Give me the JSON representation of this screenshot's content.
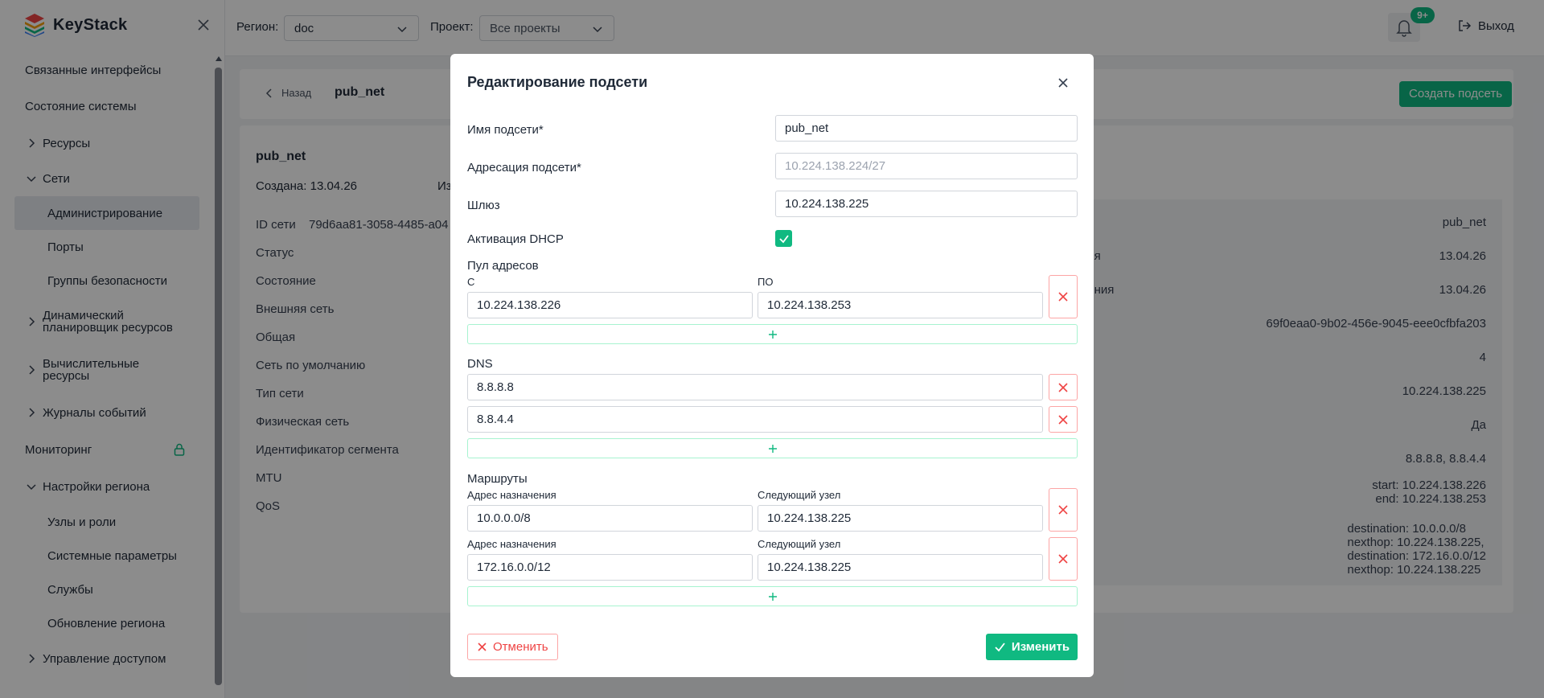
{
  "app": {
    "logo": "KeyStack"
  },
  "sidebar": {
    "items": [
      {
        "label": "Связанные интерфейсы"
      },
      {
        "label": "Состояние системы"
      },
      {
        "label": "Ресурсы"
      },
      {
        "label": "Сети"
      },
      {
        "label": "Администрирование"
      },
      {
        "label": "Порты"
      },
      {
        "label": "Группы безопасности"
      },
      {
        "label": "Динамический планировщик ресурсов"
      },
      {
        "label": "Вычислительные ресурсы"
      },
      {
        "label": "Журналы событий"
      },
      {
        "label": "Мониторинг"
      },
      {
        "label": "Настройки региона"
      },
      {
        "label": "Узлы и роли"
      },
      {
        "label": "Системные параметры"
      },
      {
        "label": "Службы"
      },
      {
        "label": "Обновление региона"
      },
      {
        "label": "Управление доступом"
      }
    ]
  },
  "topbar": {
    "region_label": "Регион:",
    "region_value": "doc",
    "project_label": "Проект:",
    "project_value": "Все проекты",
    "notifications_badge": "9+",
    "logout": "Выход"
  },
  "page": {
    "back": "Назад",
    "title": "pub_net",
    "create_button": "Создать подсеть",
    "network_name": "pub_net",
    "created": "Создана: 13.04.26",
    "changed_prefix": "Из",
    "fields": [
      {
        "label": "ID сети",
        "value": "79d6aa81-3058-4485-a04"
      },
      {
        "label": "Статус"
      },
      {
        "label": "Состояние"
      },
      {
        "label": "Внешняя сеть"
      },
      {
        "label": "Общая"
      },
      {
        "label": "Сеть по умолчанию"
      },
      {
        "label": "Тип сети"
      },
      {
        "label": "Физическая сеть"
      },
      {
        "label": "Идентификатор сегмента"
      },
      {
        "label": "MTU"
      },
      {
        "label": "QoS"
      }
    ],
    "subnet_panel": [
      {
        "label": "и",
        "value": "pub_net"
      },
      {
        "label": "ния",
        "value": "13.04.26"
      },
      {
        "label": "нения",
        "value": "13.04.26"
      },
      {
        "label": "",
        "value": "69f0eaa0-9b02-456e-9045-eee0cfbfa203"
      },
      {
        "label": "",
        "value": "4"
      },
      {
        "label": "",
        "value": "10.224.138.225"
      },
      {
        "label": "",
        "value": "Да"
      },
      {
        "label": "",
        "value": "8.8.8.8, 8.8.4.4"
      },
      {
        "label": "в",
        "value_lines": [
          "start: 10.224.138.226",
          "end: 10.224.138.253"
        ]
      },
      {
        "label": "",
        "value_lines": [
          "destination: 10.0.0.0/8",
          "nexthop: 10.224.138.225,",
          "destination: 172.16.0.0/12",
          "nexthop: 10.224.138.225"
        ]
      }
    ]
  },
  "modal": {
    "title": "Редактирование подсети",
    "subnet_name_label": "Имя подсети*",
    "subnet_name_value": "pub_net",
    "subnet_cidr_label": "Адресация подсети*",
    "subnet_cidr_value": "10.224.138.224/27",
    "gateway_label": "Шлюз",
    "gateway_value": "10.224.138.225",
    "dhcp_label": "Активация DHCP",
    "dhcp_enabled": true,
    "pool_label": "Пул адресов",
    "pool_from_label": "С",
    "pool_to_label": "ПО",
    "pool_from": "10.224.138.226",
    "pool_to": "10.224.138.253",
    "dns_label": "DNS",
    "dns": [
      "8.8.8.8",
      "8.8.4.4"
    ],
    "routes_label": "Маршруты",
    "route_dest_label": "Адрес назначения",
    "route_next_label": "Следующий узел",
    "routes": [
      {
        "destination": "10.0.0.0/8",
        "nexthop": "10.224.138.225"
      },
      {
        "destination": "172.16.0.0/12",
        "nexthop": "10.224.138.225"
      }
    ],
    "cancel": "Отменить",
    "submit": "Изменить"
  },
  "colors": {
    "accent": "#10b981",
    "danger": "#ef4444",
    "overlay": "rgba(0,0,0,0.45)"
  }
}
